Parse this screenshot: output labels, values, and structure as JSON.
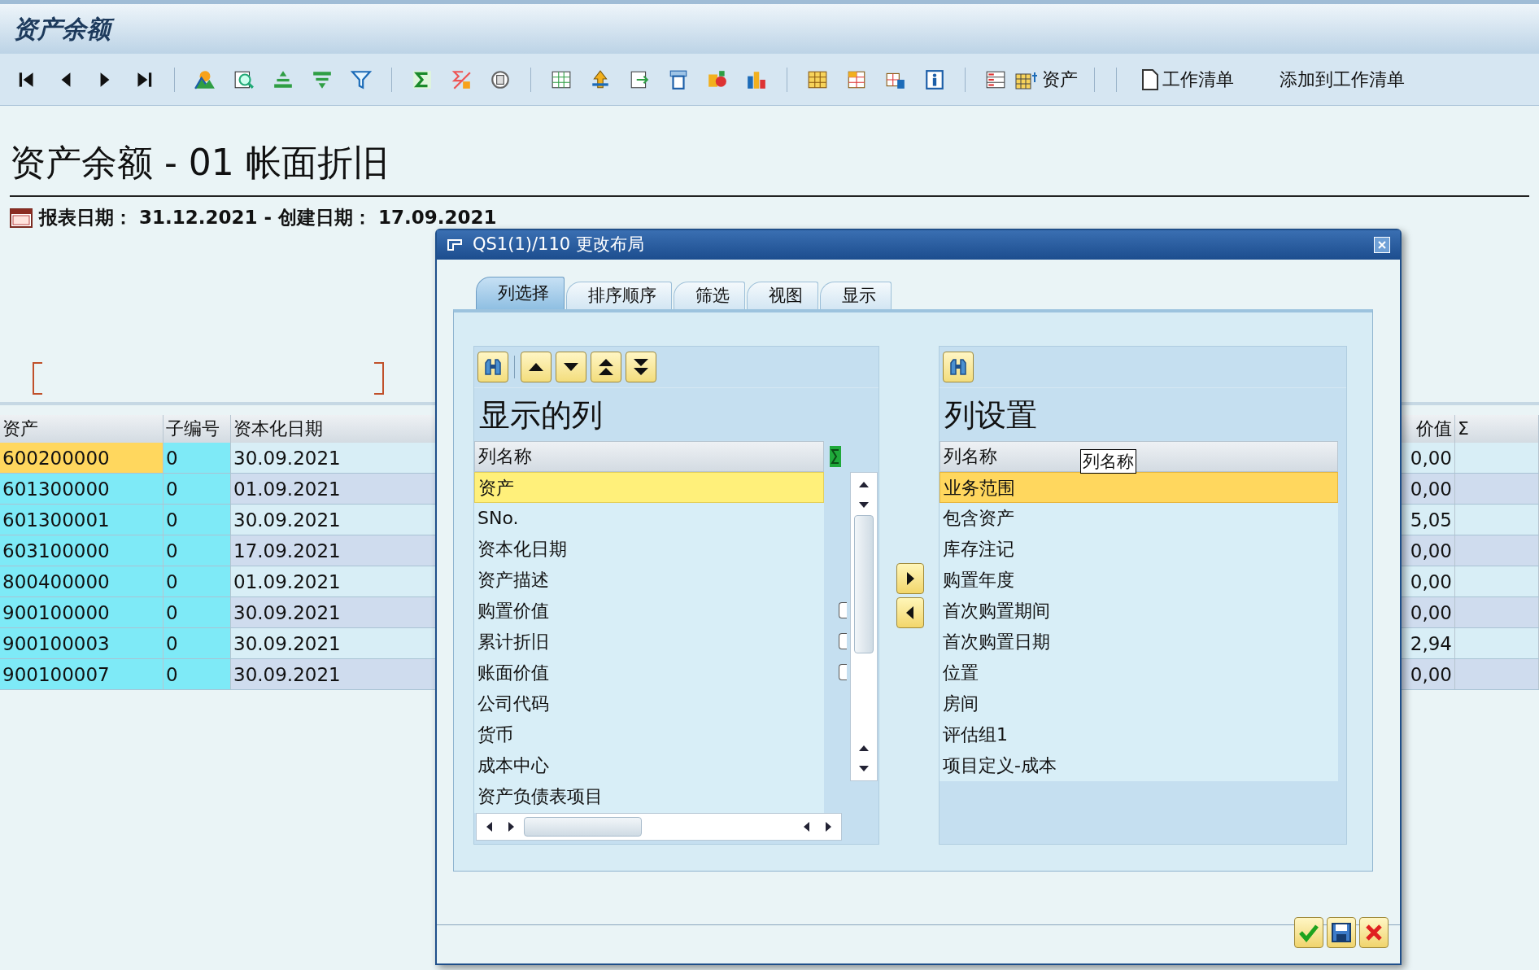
{
  "window": {
    "title": "资产余额"
  },
  "toolbar": {
    "buttons": [
      {
        "label": "资产"
      },
      {
        "label": "工作清单"
      },
      {
        "label": "添加到工作清单"
      }
    ]
  },
  "report": {
    "title": "资产余额 - 01 帐面折旧",
    "info": "报表日期： 31.12.2021 - 创建日期： 17.09.2021"
  },
  "table": {
    "columns": [
      "资产",
      "子编号",
      "资本化日期",
      "价值",
      "Σ"
    ],
    "rows": [
      {
        "asset": "600200000",
        "sub": "0",
        "date": "30.09.2021",
        "value": "0,00",
        "selected": true
      },
      {
        "asset": "601300000",
        "sub": "0",
        "date": "01.09.2021",
        "value": "0,00",
        "selected": false
      },
      {
        "asset": "601300001",
        "sub": "0",
        "date": "30.09.2021",
        "value": "5,05",
        "selected": false
      },
      {
        "asset": "603100000",
        "sub": "0",
        "date": "17.09.2021",
        "value": "0,00",
        "selected": false
      },
      {
        "asset": "800400000",
        "sub": "0",
        "date": "01.09.2021",
        "value": "0,00",
        "selected": false
      },
      {
        "asset": "900100000",
        "sub": "0",
        "date": "30.09.2021",
        "value": "0,00",
        "selected": false
      },
      {
        "asset": "900100003",
        "sub": "0",
        "date": "30.09.2021",
        "value": "2,94",
        "selected": false
      },
      {
        "asset": "900100007",
        "sub": "0",
        "date": "30.09.2021",
        "value": "0,00",
        "selected": false
      }
    ]
  },
  "dialog": {
    "title": "QS1(1)/110 更改布局",
    "tabs": [
      {
        "label": "列选择",
        "selected": true
      },
      {
        "label": "排序顺序",
        "selected": false
      },
      {
        "label": "筛选",
        "selected": false
      },
      {
        "label": "视图",
        "selected": false
      },
      {
        "label": "显示",
        "selected": false
      }
    ],
    "displayed_columns": {
      "title": "显示的列",
      "header": "列名称",
      "items": [
        {
          "label": "资产",
          "selected": true,
          "sum_checkbox": false
        },
        {
          "label": "SNo.",
          "selected": false,
          "sum_checkbox": false
        },
        {
          "label": "资本化日期",
          "selected": false,
          "sum_checkbox": false
        },
        {
          "label": "资产描述",
          "selected": false,
          "sum_checkbox": false
        },
        {
          "label": "购置价值",
          "selected": false,
          "sum_checkbox": true
        },
        {
          "label": "累计折旧",
          "selected": false,
          "sum_checkbox": true
        },
        {
          "label": "账面价值",
          "selected": false,
          "sum_checkbox": true
        },
        {
          "label": "公司代码",
          "selected": false,
          "sum_checkbox": false
        },
        {
          "label": "货币",
          "selected": false,
          "sum_checkbox": false
        },
        {
          "label": "成本中心",
          "selected": false,
          "sum_checkbox": false
        },
        {
          "label": "资产负债表项目",
          "selected": false,
          "sum_checkbox": false
        }
      ]
    },
    "column_set": {
      "title": "列设置",
      "header": "列名称",
      "tooltip": "列名称",
      "items": [
        {
          "label": "业务范围",
          "selected": true
        },
        {
          "label": "包含资产",
          "selected": false
        },
        {
          "label": "库存注记",
          "selected": false
        },
        {
          "label": "购置年度",
          "selected": false
        },
        {
          "label": "首次购置期间",
          "selected": false
        },
        {
          "label": "首次购置日期",
          "selected": false
        },
        {
          "label": "位置",
          "selected": false
        },
        {
          "label": "房间",
          "selected": false
        },
        {
          "label": "评估组1",
          "selected": false
        },
        {
          "label": "项目定义-成本",
          "selected": false
        }
      ]
    }
  }
}
